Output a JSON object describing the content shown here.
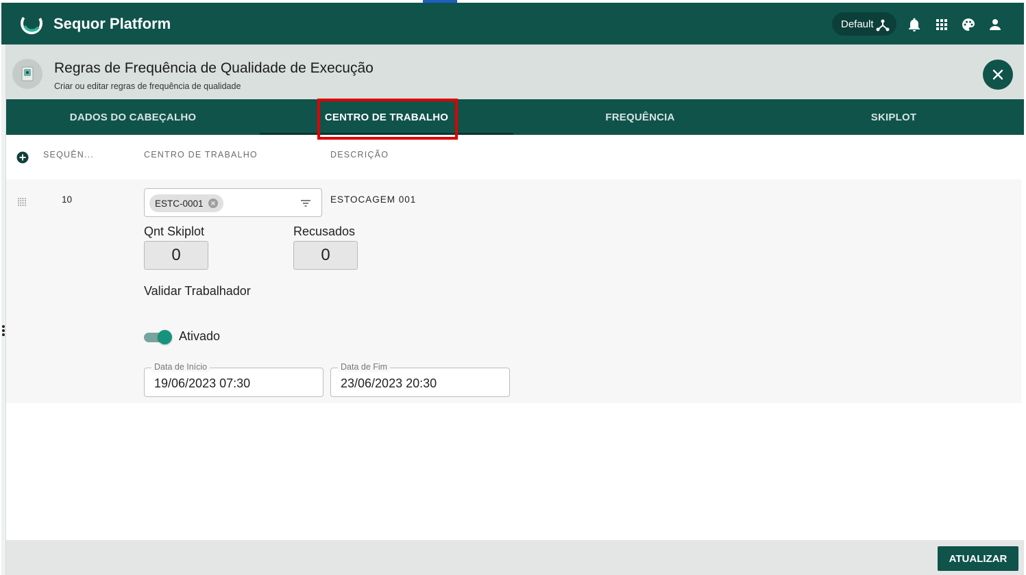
{
  "app": {
    "title": "Sequor Platform"
  },
  "topbar": {
    "environment_label": "Default",
    "icons": [
      "network-icon",
      "bell-icon",
      "apps-grid-icon",
      "palette-icon",
      "user-icon"
    ]
  },
  "page": {
    "title": "Regras de Frequência de Qualidade de Execução",
    "subtitle": "Criar ou editar regras de frequência de qualidade"
  },
  "tabs": [
    {
      "label": "DADOS DO CABEÇALHO",
      "active": false
    },
    {
      "label": "CENTRO DE TRABALHO",
      "active": true
    },
    {
      "label": "FREQUÊNCIA",
      "active": false
    },
    {
      "label": "SKIPLOT",
      "active": false
    }
  ],
  "table": {
    "columns": [
      "SEQUÊN...",
      "CENTRO DE TRABALHO",
      "DESCRIÇÃO"
    ],
    "rows": [
      {
        "sequence": "10",
        "work_center_chip": "ESTC-0001",
        "description": "ESTOCAGEM 001",
        "qnt_skiplot_label": "Qnt Skiplot",
        "qnt_skiplot_value": "0",
        "recusados_label": "Recusados",
        "recusados_value": "0",
        "validar_label": "Validar Trabalhador",
        "toggle_label": "Ativado",
        "toggle_on": true,
        "start_label": "Data de Início",
        "start_value": "19/06/2023 07:30",
        "end_label": "Data de Fim",
        "end_value": "23/06/2023 20:30"
      }
    ]
  },
  "footer": {
    "update_label": "ATUALIZAR"
  },
  "colors": {
    "primary": "#10534b",
    "highlight": "#e00000",
    "toggle": "#16937c"
  }
}
